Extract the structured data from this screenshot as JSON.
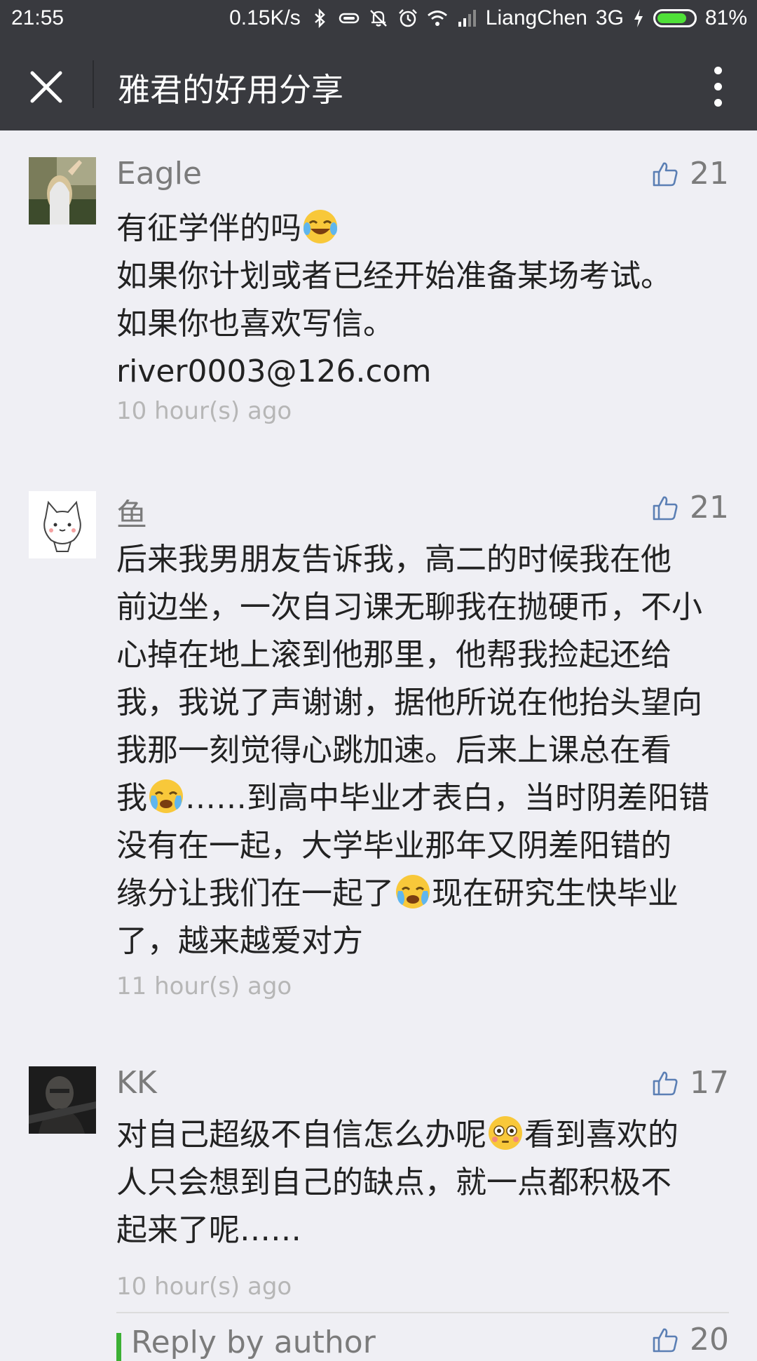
{
  "status_bar": {
    "time": "21:55",
    "speed": "0.15K/s",
    "carrier": "LiangChen",
    "network": "3G",
    "battery": "81%",
    "battery_level": 0.81
  },
  "title_bar": {
    "title": "雅君的好用分享"
  },
  "comments": [
    {
      "name": "Eagle",
      "likes": "21",
      "lines": [
        "有征学伴的吗",
        "如果你计划或者已经开始准备某场考试。",
        "如果你也喜欢写信。",
        "river0003@126.com"
      ],
      "time": "10 hour(s) ago"
    },
    {
      "name": "鱼",
      "likes": "21",
      "lines": [
        "后来我男朋友告诉我，高二的时候我在他",
        "前边坐，一次自习课无聊我在抛硬币，不小",
        "心掉在地上滚到他那里，他帮我捡起还给",
        "我，我说了声谢谢，据他所说在他抬头望向",
        "我那一刻觉得心跳加速。后来上课总在看",
        "我",
        "……到高中毕业才表白，当时阴差阳错",
        "没有在一起，大学毕业那年又阴差阳错的",
        "缘分让我们在一起了",
        "现在研究生快毕业",
        "了，越来越爱对方"
      ],
      "time": "11 hour(s) ago"
    },
    {
      "name": "KK",
      "likes": "17",
      "lines": [
        "对自己超级不自信怎么办呢",
        "看到喜欢的",
        "人只会想到自己的缺点，就一点都积极不",
        "起来了呢……"
      ],
      "time": "10 hour(s) ago"
    }
  ],
  "reply": {
    "label": "Reply by author",
    "likes": "20"
  },
  "colors": {
    "header_bg": "#393a3f",
    "page_bg": "#efeff4",
    "reply_accent": "#3cb034"
  }
}
